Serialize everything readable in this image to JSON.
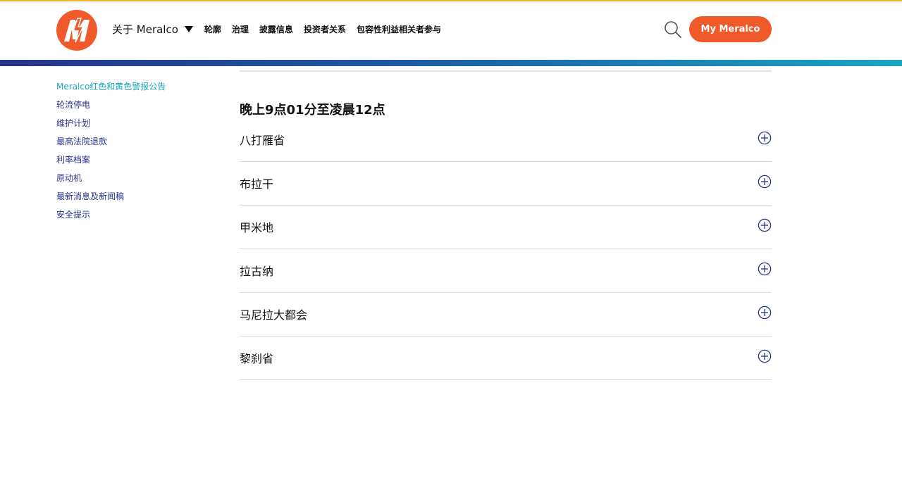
{
  "header": {
    "nav": [
      {
        "label": "关于 Meralco",
        "has_dropdown": true
      },
      {
        "label": "轮廓"
      },
      {
        "label": "治理"
      },
      {
        "label": "披露信息"
      },
      {
        "label": "投资者关系"
      },
      {
        "label": "包容性利益相关者参与"
      }
    ],
    "cta_label": "My Meralco"
  },
  "sidebar": {
    "items": [
      {
        "label": "Meralco红色和黄色警报公告",
        "active": true
      },
      {
        "label": "轮流停电"
      },
      {
        "label": "维护计划"
      },
      {
        "label": "最高法院退款"
      },
      {
        "label": "利率档案"
      },
      {
        "label": "原动机"
      },
      {
        "label": "最新消息及新闻稿"
      },
      {
        "label": "安全提示"
      }
    ]
  },
  "main": {
    "section_title": "晚上9点01分至凌晨12点",
    "accordion": [
      {
        "label": "八打雁省",
        "expanded": false
      },
      {
        "label": "布拉干",
        "expanded": false
      },
      {
        "label": "甲米地",
        "expanded": false
      },
      {
        "label": "拉古纳",
        "expanded": false
      },
      {
        "label": "马尼拉大都会",
        "expanded": false
      },
      {
        "label": "黎刹省",
        "expanded": false
      }
    ]
  },
  "colors": {
    "brand_orange": "#f0592a",
    "nav_link": "#27348b",
    "active_link": "#17a8b8",
    "top_accent": "#f2b233"
  },
  "icons": {
    "logo": "meralco-logo-icon",
    "search": "search-icon",
    "caret": "caret-down-icon",
    "expand": "plus-circle-icon"
  }
}
